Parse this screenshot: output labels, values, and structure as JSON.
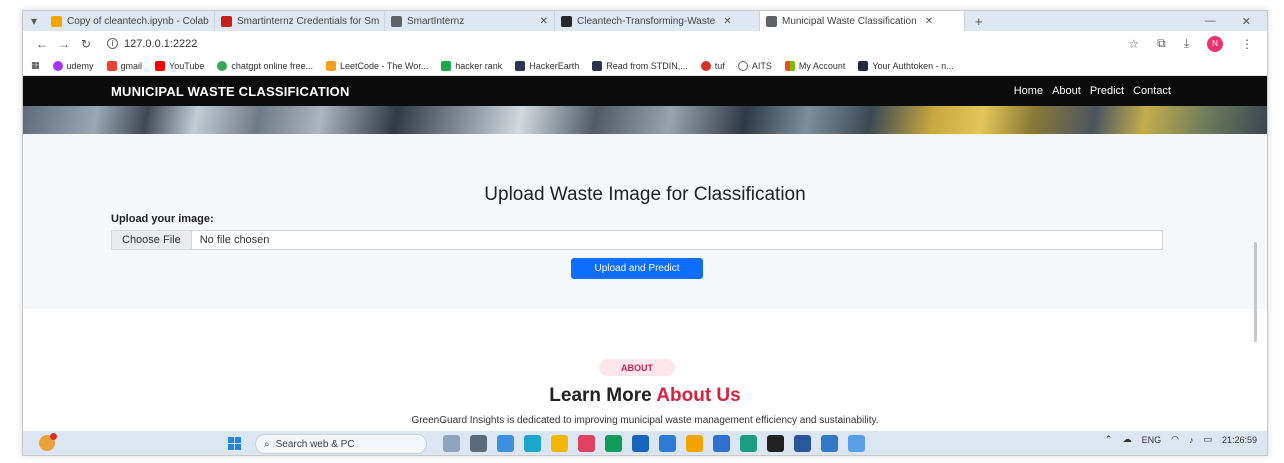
{
  "browser": {
    "tabs": [
      {
        "label": "Copy of cleantech.ipynb - Colab",
        "color": "#f2a600",
        "active": false
      },
      {
        "label": "Smartinternz Credentials for Sm",
        "color": "#c5221f",
        "active": false
      },
      {
        "label": "SmartInternz",
        "color": "#5f6368",
        "active": false
      },
      {
        "label": "Cleantech-Transforming-Waste",
        "color": "#24292f",
        "active": false
      },
      {
        "label": "Municipal Waste Classification",
        "color": "#5f6368",
        "active": true
      }
    ],
    "new_tab": "+",
    "url": "127.0.0.1:2222",
    "bookmarks": [
      {
        "label": "udemy",
        "color": "#a435f0"
      },
      {
        "label": "gmail",
        "color": "#ea4335"
      },
      {
        "label": "YouTube",
        "color": "#ff0000"
      },
      {
        "label": "chatgpt online free...",
        "color": "#34a853"
      },
      {
        "label": "LeetCode - The Wor...",
        "color": "#f89f1b"
      },
      {
        "label": "hacker rank",
        "color": "#1ba94c"
      },
      {
        "label": "HackerEarth",
        "color": "#2c3454"
      },
      {
        "label": "Read from STDIN,...",
        "color": "#2c3454"
      },
      {
        "label": "tuf",
        "color": "#d93025"
      },
      {
        "label": "AITS",
        "color": "#5f6368"
      },
      {
        "label": "My Account",
        "color": "#f25022"
      },
      {
        "label": "Your Authtoken - n...",
        "color": "#1f2a44"
      }
    ]
  },
  "site": {
    "brand": "MUNICIPAL WASTE CLASSIFICATION",
    "menu": [
      "Home",
      "About",
      "Predict",
      "Contact"
    ]
  },
  "upload": {
    "title": "Upload Waste Image for Classification",
    "label": "Upload your image:",
    "choose_button": "Choose File",
    "file_status": "No file chosen",
    "submit_button": "Upload and Predict"
  },
  "about": {
    "badge": "ABOUT",
    "title_plain": "Learn More ",
    "title_accent": "About Us",
    "text": "GreenGuard Insights is dedicated to improving municipal waste management efficiency and sustainability."
  },
  "taskbar": {
    "search_placeholder": "Search web & PC",
    "language": "ENG",
    "time": "21:26:59",
    "app_colors": [
      "#8fa4c0",
      "#5a6b7e",
      "#3d8fe0",
      "#1aa7c9",
      "#f2b705",
      "#e0425f",
      "#0f9d58",
      "#1565c0",
      "#2e7bd6",
      "#f4a300",
      "#2f6fd0",
      "#1b9c85",
      "#222222",
      "#2b579a",
      "#3178c6",
      "#5aa0e6"
    ]
  },
  "colors": {
    "accent": "#0d6efd",
    "about_accent": "#d8213e",
    "nav_bg": "#0b0b0b"
  }
}
